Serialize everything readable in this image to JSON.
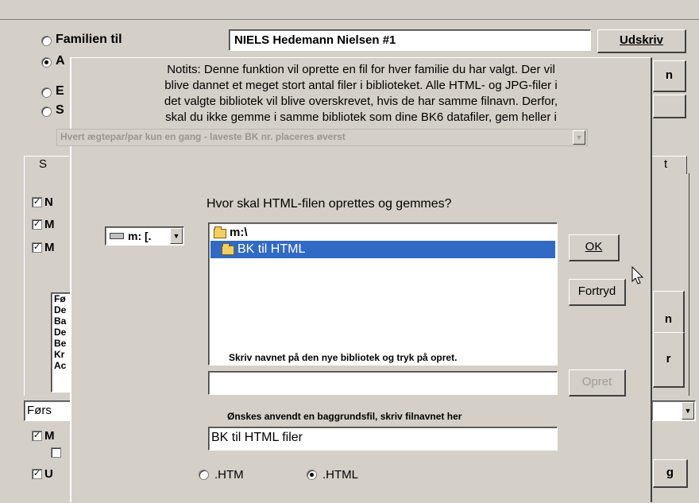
{
  "background": {
    "radios": [
      {
        "label": "Familien til",
        "checked": false
      },
      {
        "label": "A",
        "checked": true
      },
      {
        "label": "E",
        "checked": false
      },
      {
        "label": "S",
        "checked": false
      }
    ],
    "name_field": "NIELS Hedemann Nielsen  #1",
    "print_button": "Udskriv",
    "right_button_1": "n",
    "tab_left_label": "S",
    "tab_right_label": "t",
    "checks": [
      {
        "label": "N",
        "checked": true
      },
      {
        "label": "M",
        "checked": true
      },
      {
        "label": "M",
        "checked": true
      }
    ],
    "list_items": [
      "Fø",
      "De",
      "Ba",
      "De",
      "Be",
      "Kr",
      "Ac"
    ],
    "side_button_1": "n",
    "side_button_2": "r",
    "first_select": "Førs",
    "bottom_checks": [
      {
        "label": "M",
        "checked": true
      },
      {
        "label": "",
        "checked": false
      },
      {
        "label": "U",
        "checked": true
      }
    ],
    "bottom_right_button": "g"
  },
  "dialog": {
    "notice_lines": [
      "Notits: Denne funktion vil oprette en fil for hver familie du har valgt. Der vil",
      "blive dannet et meget stort antal filer i biblioteket. Alle HTML- og JPG-filer i",
      "det valgte bibliotek vil blive overskrevet, hvis de har samme filnavn. Derfor,",
      "skal du ikke gemme i samme bibliotek som dine BK6 datafiler, gem heller i"
    ],
    "disabled_select": "Hvert ægtepar/par kun en gang - laveste BK nr. placeres øverst",
    "question": "Hvor skal HTML-filen oprettes og gemmes?",
    "drive_select": "m: [.",
    "folders": [
      {
        "label": "m:\\",
        "selected": false
      },
      {
        "label": "BK til HTML",
        "selected": true
      }
    ],
    "ok_button": "OK",
    "cancel_button": "Fortryd",
    "new_folder_label": "Skriv navnet på den nye bibliotek og tryk på opret.",
    "new_folder_value": "",
    "create_button": "Opret",
    "bg_file_label": "Ønskes anvendt en baggrundsfil, skriv filnavnet her",
    "bg_file_value": "BK til HTML filer",
    "format_options": [
      {
        "label": ".HTM",
        "checked": false
      },
      {
        "label": ".HTML",
        "checked": true
      }
    ]
  }
}
